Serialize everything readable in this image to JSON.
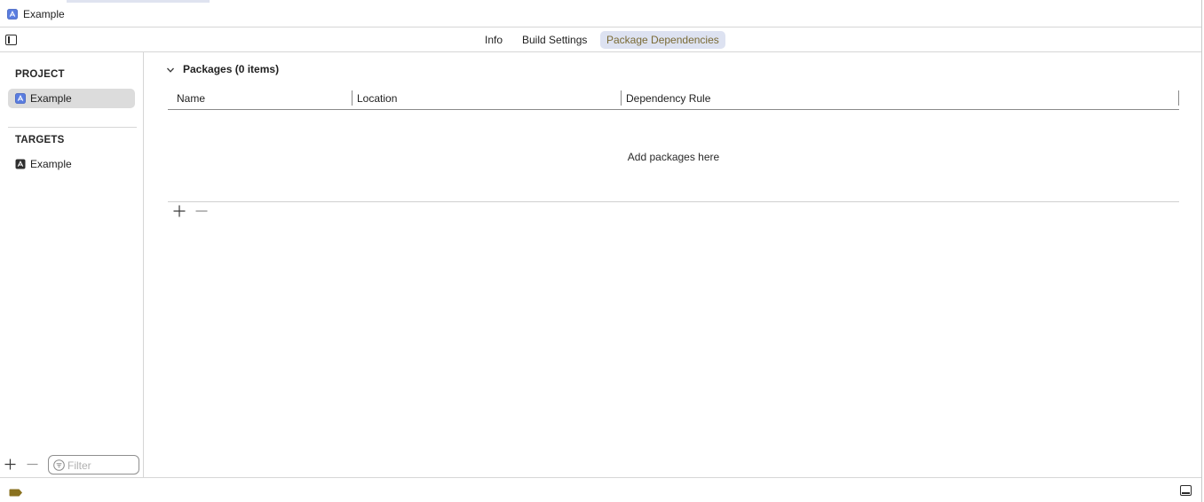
{
  "window": {
    "title": "Example"
  },
  "tabs": [
    {
      "label": "Info",
      "active": false
    },
    {
      "label": "Build Settings",
      "active": false
    },
    {
      "label": "Package Dependencies",
      "active": true
    }
  ],
  "sidebar": {
    "project_section": "PROJECT",
    "project_item": "Example",
    "targets_section": "TARGETS",
    "target_item": "Example",
    "filter_placeholder": "Filter"
  },
  "packages": {
    "title": "Packages (0 items)",
    "columns": [
      "Name",
      "Location",
      "Dependency Rule"
    ],
    "empty_message": "Add packages here"
  },
  "icons": {
    "project": "xcode-project-icon",
    "target": "app-target-icon",
    "add": "plus-icon",
    "remove": "minus-icon",
    "filter": "filter-icon",
    "disclosure": "chevron-down-icon",
    "sidebar_toggle": "sidebar-left-icon",
    "debug_area_toggle": "bottom-panel-icon",
    "status_tag": "tag-icon"
  },
  "colors": {
    "accent": "#5a7de0",
    "active_tab_bg": "#dde2f1",
    "active_tab_text": "#7a6a35",
    "selected_row": "#dcdcdc",
    "status_tag": "#8a7220"
  }
}
